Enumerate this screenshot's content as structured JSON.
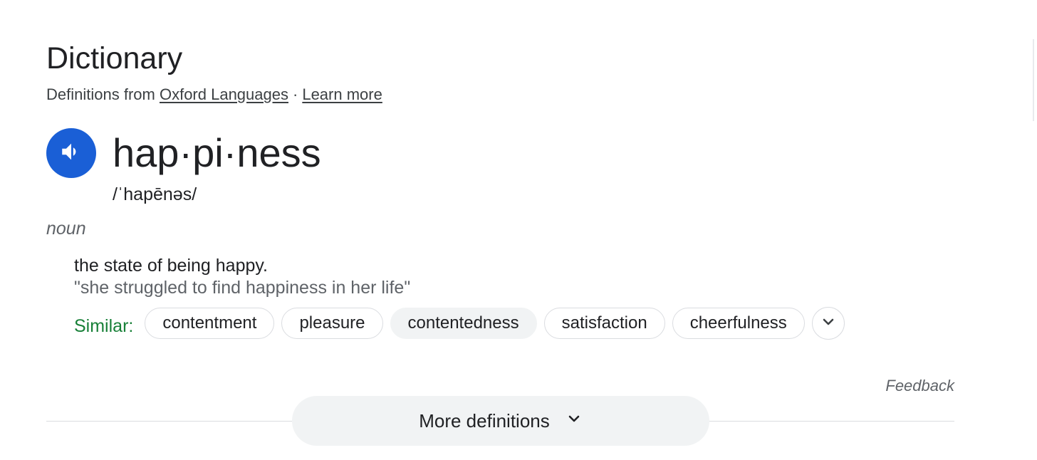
{
  "header": {
    "title": "Dictionary",
    "source_prefix": "Definitions from",
    "source_link": "Oxford Languages",
    "separator": "·",
    "learn_more": "Learn more"
  },
  "entry": {
    "headword": "hap·pi·ness",
    "phonetic": "/ˈhapēnəs/",
    "part_of_speech": "noun",
    "definition": "the state of being happy.",
    "example": "\"she struggled to find happiness in her life\""
  },
  "similar": {
    "label": "Similar:",
    "chips": [
      "contentment",
      "pleasure",
      "contentedness",
      "satisfaction",
      "cheerfulness"
    ]
  },
  "footer": {
    "feedback": "Feedback",
    "more_definitions": "More definitions"
  },
  "icons": {
    "audio": "speaker-icon",
    "expand": "chevron-down-icon"
  },
  "colors": {
    "audio_button": "#1a5fd6",
    "similar_label": "#188038",
    "chip_active_bg": "#f1f3f4"
  }
}
